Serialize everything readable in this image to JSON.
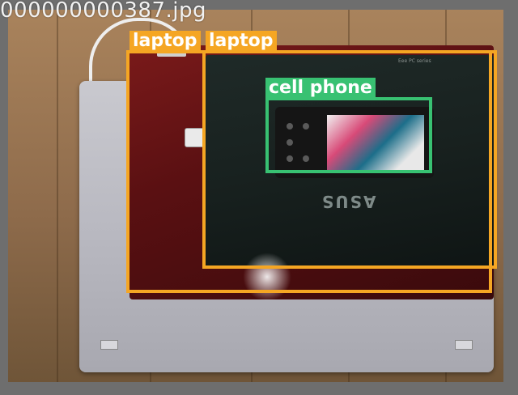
{
  "image": {
    "filename": "000000000387.jpg"
  },
  "detections": [
    {
      "label": "laptop",
      "color": "#f5a623"
    },
    {
      "label": "laptop",
      "color": "#f5a623"
    },
    {
      "label": "cell phone",
      "color": "#38c172"
    }
  ],
  "photo": {
    "logo_text": "ASUS",
    "model_text": "Eee PC series"
  }
}
